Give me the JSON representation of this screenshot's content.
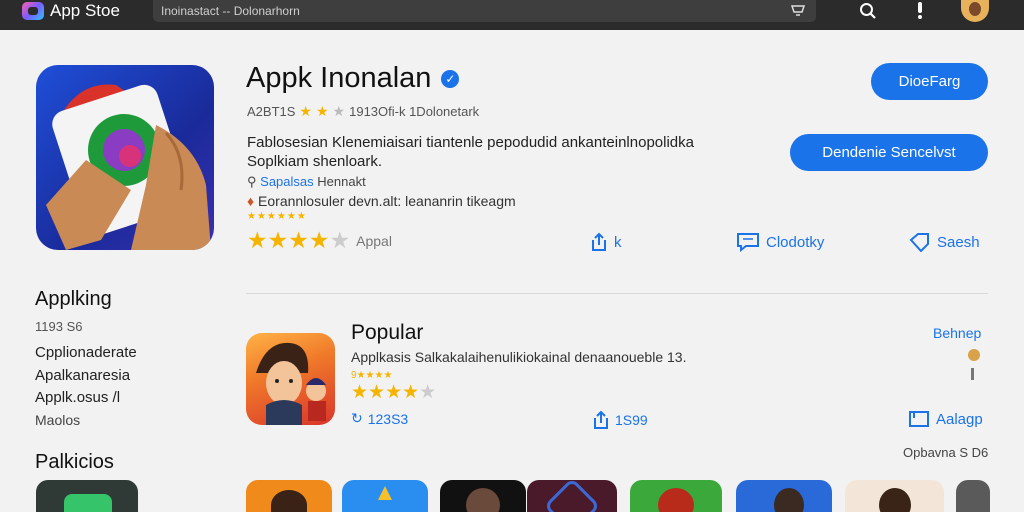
{
  "header": {
    "store_name": "App Stoe",
    "search_text": "Inoinastact -- Dolonarhorn"
  },
  "app": {
    "title": "Appk Inonalan",
    "meta_code": "A2BT1S",
    "meta_text": "1913Ofi-k 1Dolonetark",
    "description_line1": "Fablosesian Klenemiaisari tiantenle pepodudid ankanteinlnopolidka",
    "description_line2": "Soplkiam shenloark.",
    "developer_prefix": "Sapalsas",
    "developer_name": "Hennakt",
    "location": "Eorannlosuler devn.alt:  leananrin tikeagm",
    "rating_label": "Appal",
    "primary_button": "DioeFarg",
    "secondary_button": "Dendenie Sencelvst"
  },
  "actions": [
    {
      "label": "k",
      "icon": "share-icon"
    },
    {
      "label": "Clodotky",
      "icon": "comment-icon"
    },
    {
      "label": "Saesh",
      "icon": "tag-icon"
    }
  ],
  "left_panel": {
    "heading": "Applking",
    "number": "1193 S6",
    "items": [
      "Cpplionaderate",
      "Apalkanaresia",
      "Applk.osus /l",
      "Maolos"
    ],
    "heading2": "Palkicios"
  },
  "popular": {
    "title": "Popular",
    "description": "Applkasis Salkakalaihenulikiokainal denaanoueble 13.",
    "count": "123S3",
    "share_count": "1S99",
    "link": "Behnep",
    "action": "Aalagp",
    "footer": "Opbavna S D6"
  },
  "colors": {
    "accent": "#1a73e8",
    "star": "#f5b400",
    "topbar": "#2b2b2b"
  }
}
